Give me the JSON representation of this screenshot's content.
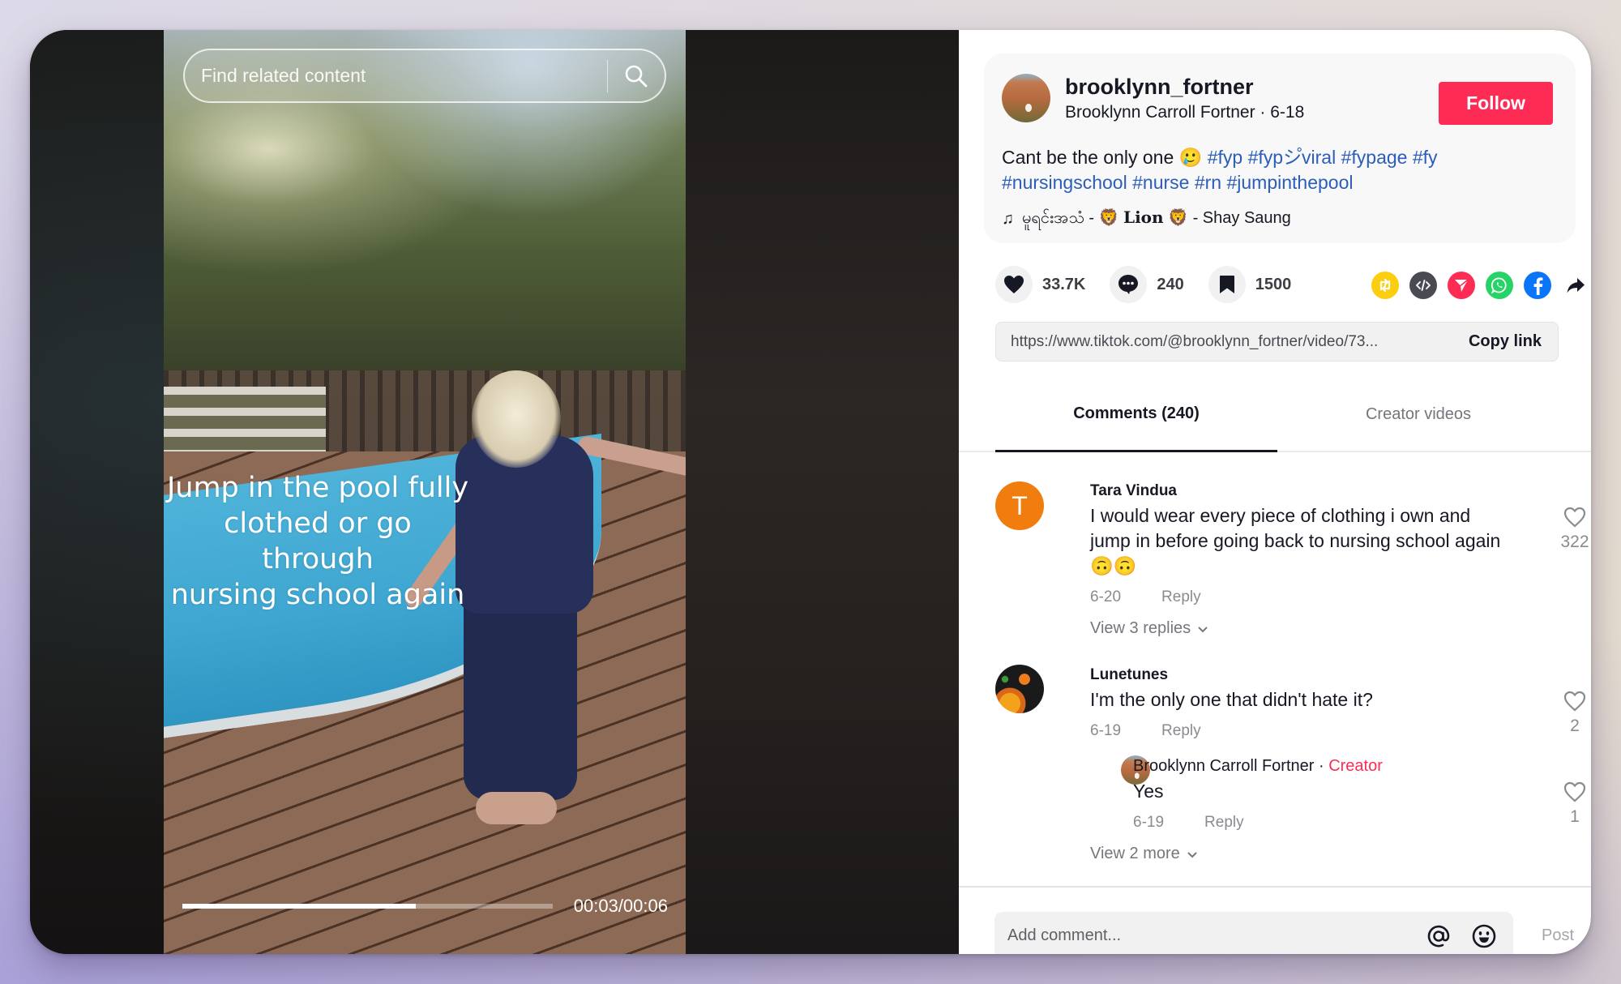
{
  "video": {
    "search_placeholder": "Find related content",
    "overlay_caption_lines": [
      "Jump in the pool fully",
      "clothed or go through",
      "nursing school again"
    ],
    "time_readout": "00:03/00:06",
    "progress_fraction": 0.63
  },
  "author": {
    "username": "brooklynn_fortner",
    "display_name": "Brooklynn Carroll Fortner",
    "date": "6-18",
    "subline": "Brooklynn Carroll Fortner · 6-18",
    "follow_label": "Follow"
  },
  "post": {
    "caption_text": "Cant be the only one 🥲 ",
    "hashtags": [
      "#fyp",
      "#fypシ゚viral",
      "#fypage",
      "#fy",
      "#nursingschool",
      "#nurse",
      "#rn",
      "#jumpinthepool"
    ],
    "music_icon": "♫",
    "music_title_pre": "မူရင်းအသံ - 🦁 ",
    "music_title_lion": "Lion",
    "music_title_post": " 🦁 - Shay Saung"
  },
  "stats": {
    "likes": "33.7K",
    "comments": "240",
    "saves": "1500"
  },
  "share_icons": [
    {
      "name": "repost-icon",
      "color": "#fcce10"
    },
    {
      "name": "embed-icon",
      "color": "#4a4a52"
    },
    {
      "name": "send-to-friends-icon",
      "color": "#fe2c55"
    },
    {
      "name": "whatsapp-icon",
      "color": "#25d366"
    },
    {
      "name": "facebook-icon",
      "color": "#0a75f6"
    },
    {
      "name": "share-arrow-icon",
      "color": "#161823"
    }
  ],
  "link": {
    "url": "https://www.tiktok.com/@brooklynn_fortner/video/73...",
    "copy_label": "Copy link"
  },
  "tabs": {
    "comments_label": "Comments (240)",
    "creator_videos_label": "Creator videos"
  },
  "comments": [
    {
      "author": "Tara Vindua",
      "avatar_letter": "T",
      "avatar_color": "#f07d0d",
      "text_line1": "I would wear every piece of clothing i own and",
      "text_line2": "jump in before going back to nursing school again",
      "text_line3": "🙃🙃",
      "date": "6-20",
      "reply_label": "Reply",
      "likes": "322",
      "view_replies_label": "View 3 replies"
    },
    {
      "author": "Lunetunes",
      "text": "I'm the only one that didn't hate it?",
      "date": "6-19",
      "reply_label": "Reply",
      "likes": "2",
      "replies": [
        {
          "author": "Brooklynn Carroll Fortner",
          "separator": " · ",
          "badge": "Creator",
          "text": "Yes",
          "date": "6-19",
          "reply_label": "Reply",
          "likes": "1"
        }
      ],
      "view_more_label": "View 2 more"
    }
  ],
  "composer": {
    "placeholder": "Add comment...",
    "post_label": "Post"
  },
  "colors": {
    "brand_red": "#fe2c55",
    "hashtag_blue": "#2b5db9",
    "text_primary": "#161823"
  }
}
